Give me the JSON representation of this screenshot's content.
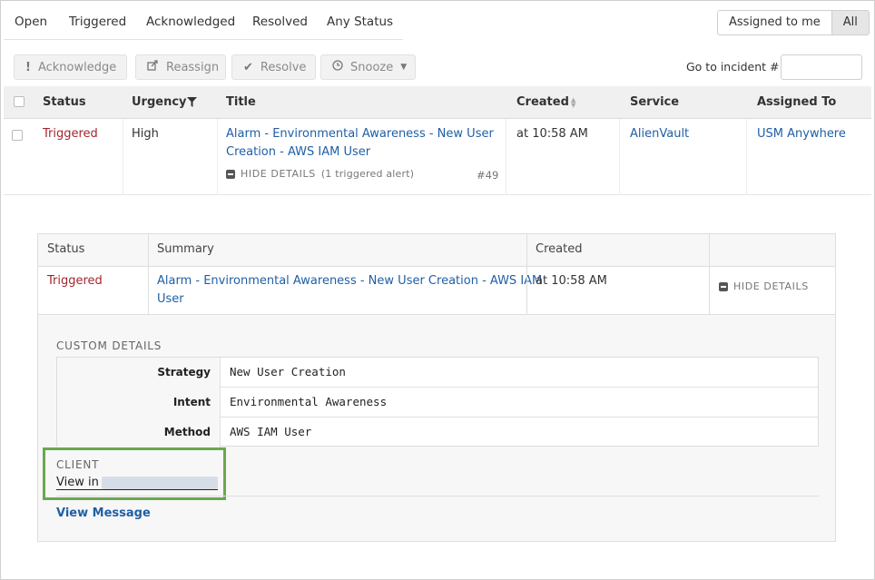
{
  "tabs": [
    "Open",
    "Triggered",
    "Acknowledged",
    "Resolved",
    "Any Status"
  ],
  "assign_toggle": {
    "mine": "Assigned to me",
    "all": "All",
    "selected": "All"
  },
  "toolbar": {
    "acknowledge": "Acknowledge",
    "reassign": "Reassign",
    "resolve": "Resolve",
    "snooze": "Snooze",
    "goto_label": "Go to incident # :",
    "goto_value": ""
  },
  "table": {
    "headers": {
      "status": "Status",
      "urgency": "Urgency",
      "title": "Title",
      "created": "Created",
      "service": "Service",
      "assigned": "Assigned To"
    },
    "row": {
      "status": "Triggered",
      "urgency": "High",
      "title_line1": "Alarm - Environmental Awareness - New User",
      "title_line2": "Creation - AWS IAM User",
      "hide_details": "HIDE DETAILS",
      "alert_count": "(1 triggered alert)",
      "number": "#49",
      "created": "at 10:58 AM",
      "service": "AlienVault",
      "assigned": "USM Anywhere"
    }
  },
  "details": {
    "headers": {
      "status": "Status",
      "summary": "Summary",
      "created": "Created"
    },
    "row": {
      "status": "Triggered",
      "summary_line1": "Alarm - Environmental Awareness - New User Creation - AWS IAM",
      "summary_line2": "User",
      "created": "at 10:58 AM",
      "hide_details": "HIDE DETAILS"
    },
    "custom_label": "CUSTOM DETAILS",
    "custom": [
      {
        "key": "Strategy",
        "value": "New User Creation"
      },
      {
        "key": "Intent",
        "value": "Environmental Awareness"
      },
      {
        "key": "Method",
        "value": "AWS IAM User"
      }
    ],
    "client_label": "CLIENT",
    "view_in": "View in",
    "view_message": "View Message"
  },
  "colors": {
    "triggered": "#a3262f",
    "link": "#1f5fa6",
    "highlight": "#6aa84f"
  }
}
